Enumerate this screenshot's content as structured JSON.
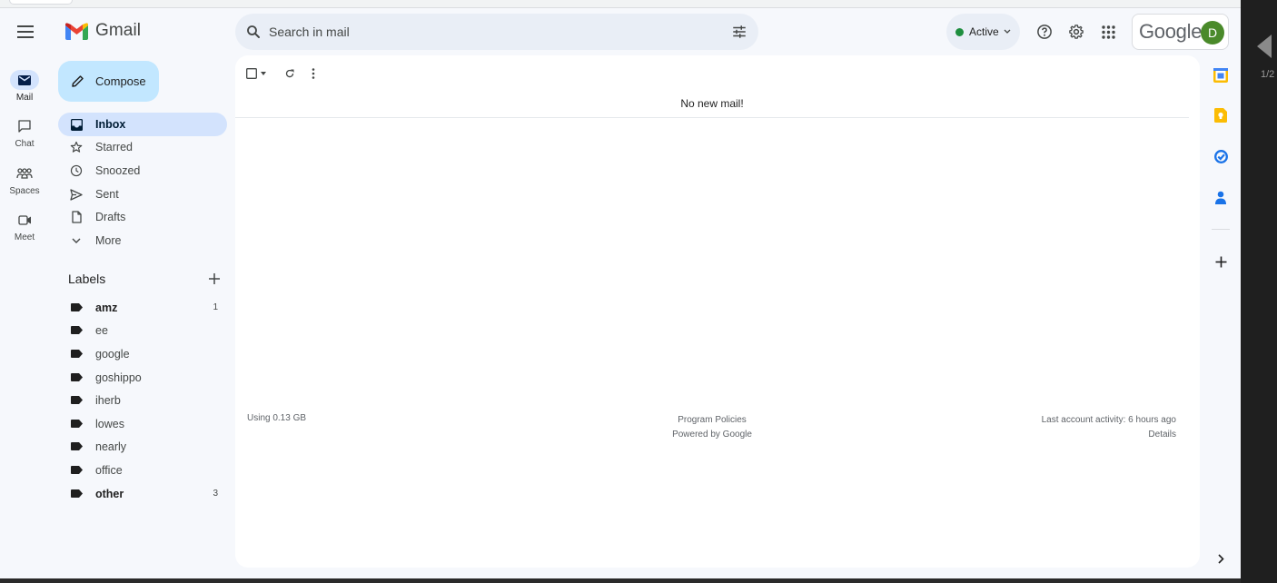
{
  "app": {
    "name": "Gmail",
    "brand": "Google",
    "avatar_letter": "D"
  },
  "search": {
    "placeholder": "Search in mail"
  },
  "status": {
    "label": "Active",
    "color": "#1e8e3e"
  },
  "rail": [
    {
      "label": "Mail",
      "icon": "mail-icon",
      "active": true
    },
    {
      "label": "Chat",
      "icon": "chat-icon"
    },
    {
      "label": "Spaces",
      "icon": "spaces-icon"
    },
    {
      "label": "Meet",
      "icon": "meet-icon"
    }
  ],
  "compose": {
    "label": "Compose"
  },
  "nav": [
    {
      "label": "Inbox",
      "icon": "inbox-icon",
      "active": true
    },
    {
      "label": "Starred",
      "icon": "star-icon"
    },
    {
      "label": "Snoozed",
      "icon": "clock-icon"
    },
    {
      "label": "Sent",
      "icon": "send-icon"
    },
    {
      "label": "Drafts",
      "icon": "draft-icon"
    },
    {
      "label": "More",
      "icon": "chevron-down-icon"
    }
  ],
  "labels": {
    "heading": "Labels",
    "items": [
      {
        "name": "amz",
        "count": "1",
        "bold": true
      },
      {
        "name": "ee"
      },
      {
        "name": "google"
      },
      {
        "name": "goshippo"
      },
      {
        "name": "iherb"
      },
      {
        "name": "lowes"
      },
      {
        "name": "nearly"
      },
      {
        "name": "office"
      },
      {
        "name": "other",
        "count": "3",
        "bold": true
      }
    ]
  },
  "main": {
    "empty_message": "No new mail!",
    "footer": {
      "storage": "Using 0.13 GB",
      "policies": "Program Policies",
      "powered": "Powered by Google",
      "activity": "Last account activity: 6 hours ago",
      "details": "Details"
    }
  },
  "viewer": {
    "page_indicator": "1/2"
  }
}
